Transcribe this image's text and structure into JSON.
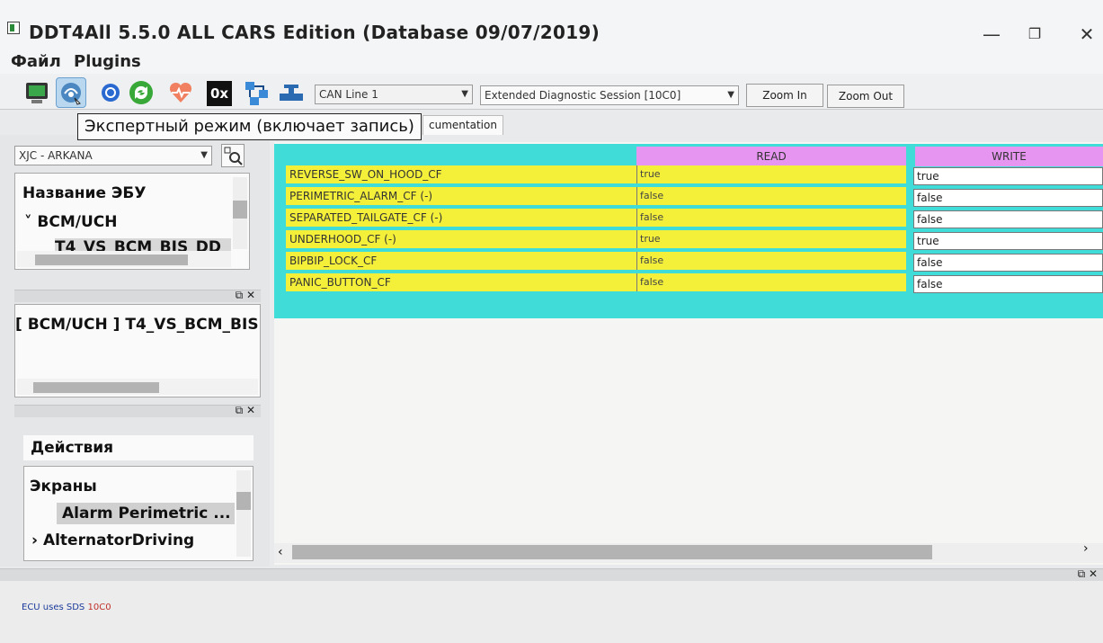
{
  "window": {
    "title": "DDT4All 5.5.0 ALL CARS Edition (Database 09/07/2019)",
    "controls": [
      "—",
      "❐",
      "✕"
    ]
  },
  "menubar": {
    "items": [
      "Файл",
      "Plugins"
    ]
  },
  "toolbar": {
    "icons": [
      "diagnostic-screen-icon",
      "expert-mode-icon",
      "refresh-icon",
      "connect-icon",
      "heartbeat-icon",
      "hex-icon",
      "network-icon",
      "valve-icon"
    ],
    "hex_label": "0x",
    "can_line": "CAN Line 1",
    "session": "Extended Diagnostic Session [10C0]",
    "zoom_in": "Zoom In",
    "zoom_out": "Zoom Out"
  },
  "tooltip": {
    "text": "Экспертный режим (включает запись)"
  },
  "tabs": {
    "documentation": "cumentation"
  },
  "left_panel": {
    "vehicle_select": "XJC - ARKANA",
    "ecu_tree": {
      "header": "Название ЭБУ",
      "group": "BCM/UCH",
      "item": "T4_VS_BCM_BIS_DD"
    },
    "ecu_label": "[ BCM/UCH ] T4_VS_BCM_BIS",
    "actions": {
      "header": "Действия",
      "screens_label": "Экраны",
      "selected_screen": "Alarm Perimetric ...",
      "next_item": "AlternatorDriving"
    }
  },
  "params": {
    "read_header": "READ",
    "write_header": "WRITE",
    "rows": [
      {
        "label": "REVERSE_SW_ON_HOOD_CF",
        "read": "true",
        "write": "true"
      },
      {
        "label": "PERIMETRIC_ALARM_CF (-)",
        "read": "false",
        "write": "false"
      },
      {
        "label": "SEPARATED_TAILGATE_CF (-)",
        "read": "false",
        "write": "false"
      },
      {
        "label": "UNDERHOOD_CF (-)",
        "read": "true",
        "write": "true"
      },
      {
        "label": "BIPBIP_LOCK_CF",
        "read": "false",
        "write": "false"
      },
      {
        "label": "PANIC_BUTTON_CF",
        "read": "false",
        "write": "false"
      }
    ]
  },
  "status": {
    "text": "ECU uses SDS",
    "code": "10C0"
  },
  "colors": {
    "grid_bg": "#3fdcd8",
    "header_bg": "#e695f0",
    "label_bg": "#f4f03a"
  }
}
